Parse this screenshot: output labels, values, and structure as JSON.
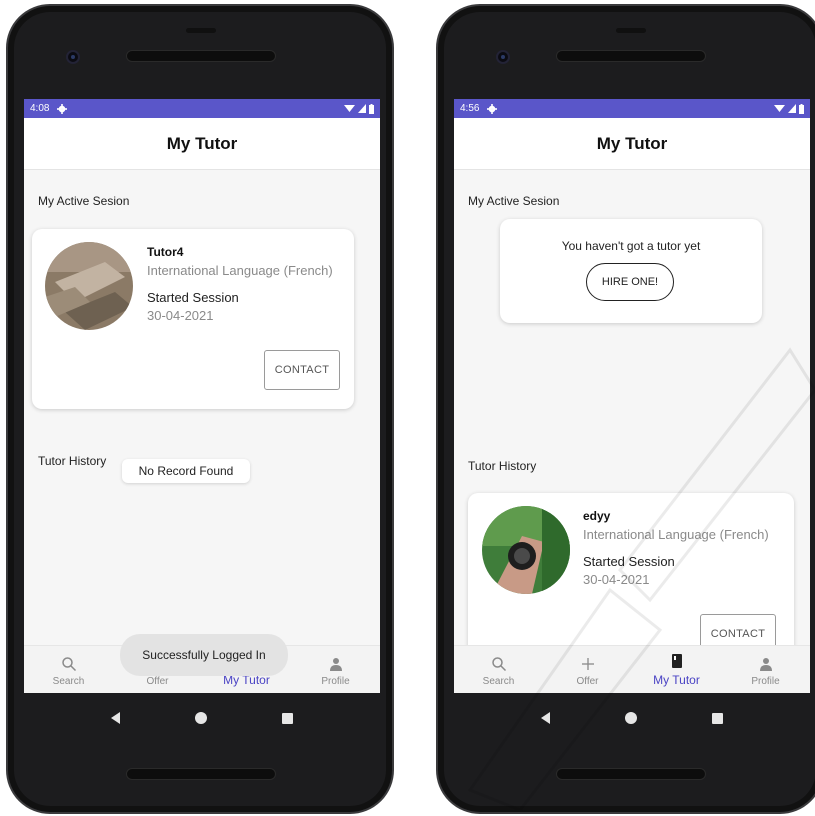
{
  "left_screen": {
    "status": {
      "time": "4:08"
    },
    "header": {
      "title": "My Tutor"
    },
    "active_section_label": "My Active Sesion",
    "active_card": {
      "name": "Tutor4",
      "subject": "International Language (French)",
      "started_label": "Started Session",
      "date": "30-04-2021",
      "contact_label": "CONTACT"
    },
    "history_label": "Tutor History",
    "history_empty": "No Record Found",
    "toast": "Successfully Logged In",
    "nav": [
      {
        "label": "Search",
        "icon": "search-icon"
      },
      {
        "label": "Offer",
        "icon": "plus-icon"
      },
      {
        "label": "My Tutor",
        "icon": "book-icon"
      },
      {
        "label": "Profile",
        "icon": "person-icon"
      }
    ]
  },
  "right_screen": {
    "status": {
      "time": "4:56"
    },
    "header": {
      "title": "My Tutor"
    },
    "active_section_label": "My Active Sesion",
    "empty_card": {
      "message": "You haven't got a tutor yet",
      "hire_label": "HIRE ONE!"
    },
    "history_label": "Tutor History",
    "history_card": {
      "name": "edyy",
      "subject": "International Language (French)",
      "started_label": "Started Session",
      "date": "30-04-2021",
      "contact_label": "CONTACT"
    },
    "nav": [
      {
        "label": "Search",
        "icon": "search-icon"
      },
      {
        "label": "Offer",
        "icon": "plus-icon"
      },
      {
        "label": "My Tutor",
        "icon": "book-icon"
      },
      {
        "label": "Profile",
        "icon": "person-icon"
      }
    ]
  },
  "colors": {
    "status_bar": "#5a56c9",
    "active_nav": "#4a43c4",
    "screen_bg": "#f6f6f6"
  }
}
